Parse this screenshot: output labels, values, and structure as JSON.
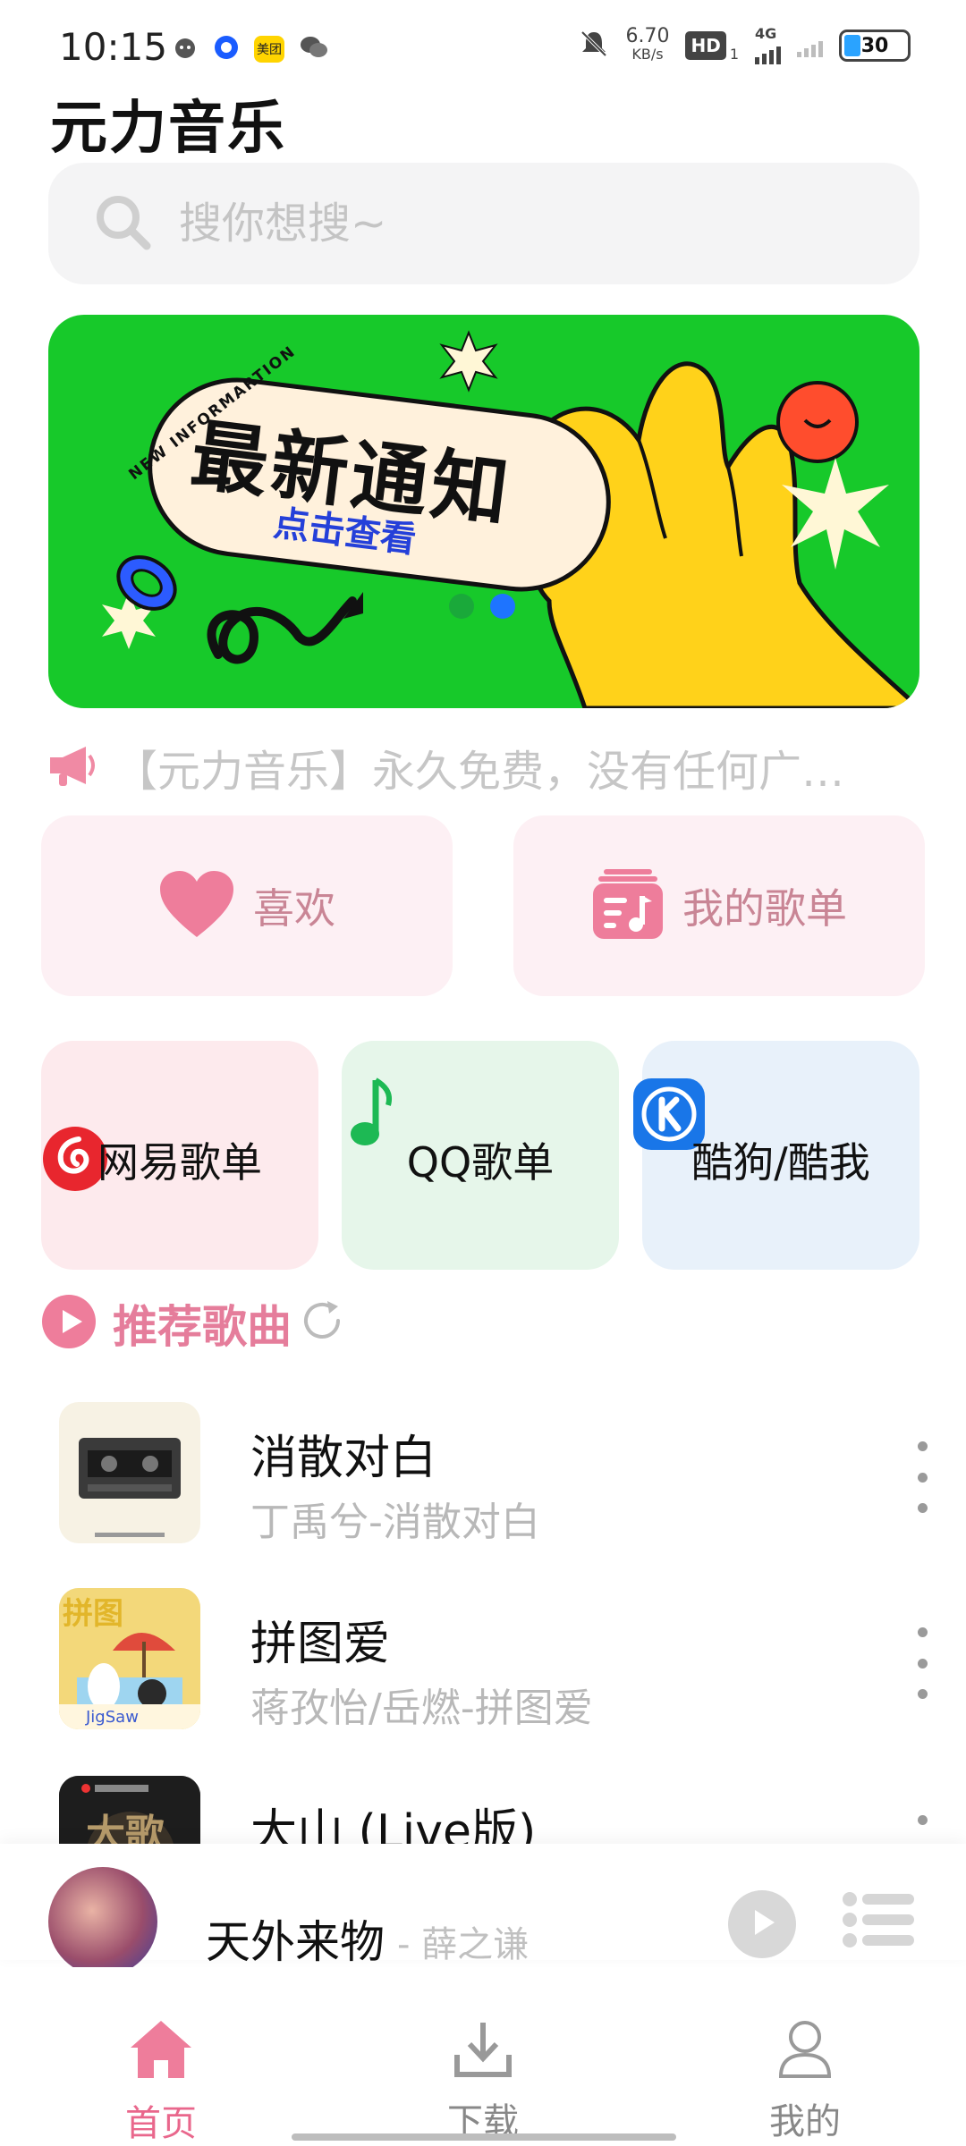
{
  "status_bar": {
    "time": "10:15",
    "net_speed_value": "6.70",
    "net_speed_unit": "KB/s",
    "hd": "HD",
    "hd_sub": "1",
    "network": "4G",
    "battery": "30",
    "left_icons": [
      "cat-icon",
      "browser-icon",
      "meituan-icon",
      "wechat-icon"
    ],
    "meituan_label": "美团"
  },
  "app": {
    "title": "元力音乐"
  },
  "search": {
    "placeholder": "搜你想搜~"
  },
  "banner": {
    "tag": "NEW INFORMARTION",
    "title": "最新通知",
    "subtitle": "点击查看",
    "slide_count": 2,
    "active_slide": 2,
    "background": "#17c92a"
  },
  "notice": {
    "text": "【元力音乐】永久免费，没有任何广…"
  },
  "quick_actions": [
    {
      "label": "喜欢",
      "icon": "heart-icon"
    },
    {
      "label": "我的歌单",
      "icon": "playlist-icon"
    }
  ],
  "sources": [
    {
      "label": "网易歌单",
      "icon": "netease-icon",
      "bg": "#fdeaed"
    },
    {
      "label": "QQ歌单",
      "icon": "qq-music-icon",
      "bg": "#e6f6ea"
    },
    {
      "label": "酷狗/酷我",
      "icon": "kugou-icon",
      "bg": "#e8f1fa"
    }
  ],
  "recommend": {
    "title": "推荐歌曲",
    "accent": "#e57d9b"
  },
  "songs": [
    {
      "title": "消散对白",
      "subtitle": "丁禹兮-消散对白"
    },
    {
      "title": "拼图爱",
      "subtitle": "蒋孜怡/岳燃-拼图爱"
    },
    {
      "title": "大山 (Live版)",
      "subtitle": ""
    }
  ],
  "player": {
    "title": "天外来物",
    "artist": "- 薛之谦"
  },
  "tabs": [
    {
      "label": "首页",
      "icon": "home-icon",
      "active": true
    },
    {
      "label": "下载",
      "icon": "download-icon",
      "active": false
    },
    {
      "label": "我的",
      "icon": "profile-icon",
      "active": false
    }
  ]
}
